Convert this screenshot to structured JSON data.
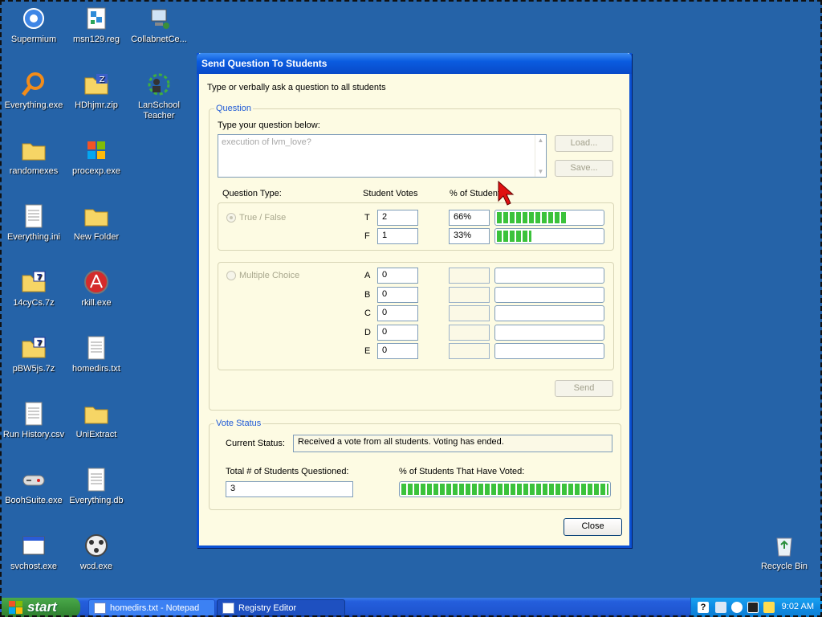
{
  "desktop": {
    "icons": [
      {
        "label": "Supermium",
        "icon": "supermium-icon"
      },
      {
        "label": "msn129.reg",
        "icon": "registry-file-icon"
      },
      {
        "label": "CollabnetCe...",
        "icon": "network-computer-icon"
      },
      {
        "label": "Everything.exe",
        "icon": "magnifier-icon"
      },
      {
        "label": "HDhjmr.zip",
        "icon": "zip-folder-icon"
      },
      {
        "label": "LanSchool Teacher",
        "icon": "lanschool-icon"
      },
      {
        "label": "randomexes",
        "icon": "folder-icon"
      },
      {
        "label": "procexp.exe",
        "icon": "windows-logo-icon"
      },
      {
        "label": "Everything.ini",
        "icon": "ini-file-icon"
      },
      {
        "label": "New Folder",
        "icon": "folder-icon"
      },
      {
        "label": "14cyCs.7z",
        "icon": "7z-folder-icon"
      },
      {
        "label": "rkill.exe",
        "icon": "rkill-icon"
      },
      {
        "label": "pBW5js.7z",
        "icon": "7z-folder-icon"
      },
      {
        "label": "homedirs.txt",
        "icon": "text-file-icon"
      },
      {
        "label": "Run History.csv",
        "icon": "csv-file-icon"
      },
      {
        "label": "UniExtract",
        "icon": "folder-icon"
      },
      {
        "label": "BoohSuite.exe",
        "icon": "gamepad-icon"
      },
      {
        "label": "Everything.db",
        "icon": "db-file-icon"
      },
      {
        "label": "svchost.exe",
        "icon": "window-app-icon"
      },
      {
        "label": "wcd.exe",
        "icon": "film-reel-icon"
      },
      {
        "label": "Recycle Bin",
        "icon": "recycle-bin-icon"
      }
    ]
  },
  "dialog": {
    "title": "Send Question To Students",
    "instructions": "Type or verbally ask a question to all students",
    "question_group": {
      "title": "Question",
      "prompt": "Type your question below:",
      "question_text": "execution of lvm_love?",
      "load_label": "Load...",
      "save_label": "Save..."
    },
    "columns": {
      "type": "Question Type:",
      "votes": "Student Votes",
      "percent": "% of Students"
    },
    "true_false": {
      "label": "True / False",
      "selected": true,
      "rows": [
        {
          "key": "T",
          "votes": "2",
          "percent": "66%",
          "fraction": 0.66
        },
        {
          "key": "F",
          "votes": "1",
          "percent": "33%",
          "fraction": 0.33
        }
      ]
    },
    "multiple_choice": {
      "label": "Multiple Choice",
      "selected": false,
      "rows": [
        {
          "key": "A",
          "votes": "0",
          "percent": "",
          "fraction": 0
        },
        {
          "key": "B",
          "votes": "0",
          "percent": "",
          "fraction": 0
        },
        {
          "key": "C",
          "votes": "0",
          "percent": "",
          "fraction": 0
        },
        {
          "key": "D",
          "votes": "0",
          "percent": "",
          "fraction": 0
        },
        {
          "key": "E",
          "votes": "0",
          "percent": "",
          "fraction": 0
        }
      ]
    },
    "send_label": "Send",
    "vote_status": {
      "title": "Vote Status",
      "current_status_label": "Current Status:",
      "current_status": "Received a vote from all students. Voting has ended.",
      "total_label": "Total # of Students Questioned:",
      "total_value": "3",
      "voted_label": "% of  Students That Have Voted:",
      "voted_fraction": 1.0
    },
    "close_label": "Close"
  },
  "taskbar": {
    "start_label": "start",
    "tasks": [
      {
        "label": "homedirs.txt - Notepad",
        "active": false
      },
      {
        "label": "Registry Editor",
        "active": true
      }
    ],
    "clock": "9:02 AM"
  },
  "colors": {
    "desktop": "#2563a8",
    "dialog_bg": "#fdfbe3",
    "title_blue": "#0a5ce0",
    "progress_green": "#3bc23b",
    "group_title": "#1f5ad6"
  }
}
